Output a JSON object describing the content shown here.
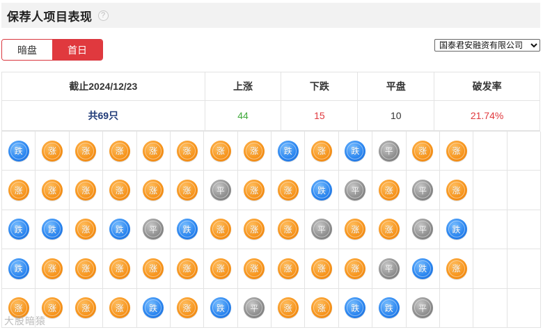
{
  "header": {
    "title": "保荐人项目表现",
    "help_glyph": "?"
  },
  "toggle": {
    "dark": "暗盘",
    "first_day": "首日",
    "active": "首日"
  },
  "broker_select": {
    "selected": "国泰君安融资有限公司"
  },
  "summary": {
    "headers": [
      "截止2024/12/23",
      "上涨",
      "下跌",
      "平盘",
      "破发率"
    ],
    "values": [
      "共69只",
      "44",
      "15",
      "10",
      "21.74%"
    ]
  },
  "coins": {
    "labels": {
      "up": "涨",
      "down": "跌",
      "flat": "平"
    },
    "columns": 16,
    "rows": [
      [
        "down",
        "up",
        "up",
        "up",
        "up",
        "up",
        "up",
        "up",
        "down",
        "up",
        "down",
        "flat",
        "up",
        "up"
      ],
      [
        "up",
        "up",
        "up",
        "up",
        "up",
        "up",
        "flat",
        "up",
        "up",
        "down",
        "flat",
        "up",
        "flat",
        "up"
      ],
      [
        "down",
        "down",
        "up",
        "down",
        "flat",
        "down",
        "up",
        "up",
        "up",
        "flat",
        "up",
        "up",
        "flat",
        "down"
      ],
      [
        "down",
        "up",
        "up",
        "up",
        "up",
        "up",
        "up",
        "up",
        "up",
        "up",
        "up",
        "flat",
        "down",
        "up"
      ],
      [
        "up",
        "up",
        "up",
        "up",
        "down",
        "up",
        "down",
        "flat",
        "up",
        "up",
        "down",
        "down",
        "flat"
      ]
    ]
  },
  "watermark": "大股暗猿",
  "colors": {
    "accent": "#e0393e",
    "up": "#f7951d",
    "down": "#2b86f0",
    "flat": "#8f8f8f",
    "rise_text": "#3fa93b"
  }
}
